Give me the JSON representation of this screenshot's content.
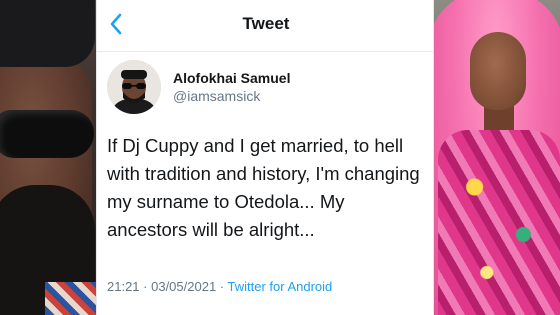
{
  "header": {
    "title": "Tweet",
    "back_icon": "chevron-left-icon"
  },
  "author": {
    "display_name": "Alofokhai Samuel",
    "handle": "@iamsamsick"
  },
  "tweet": {
    "text": "If Dj Cuppy and I get married, to hell with tradition and history, I'm changing my surname to Otedola... My ancestors will be alright...",
    "time": "21:21",
    "date": "03/05/2021",
    "separator": " · ",
    "source": "Twitter for Android"
  },
  "colors": {
    "accent": "#1da1f2",
    "text": "#14171a",
    "secondary": "#657786"
  }
}
